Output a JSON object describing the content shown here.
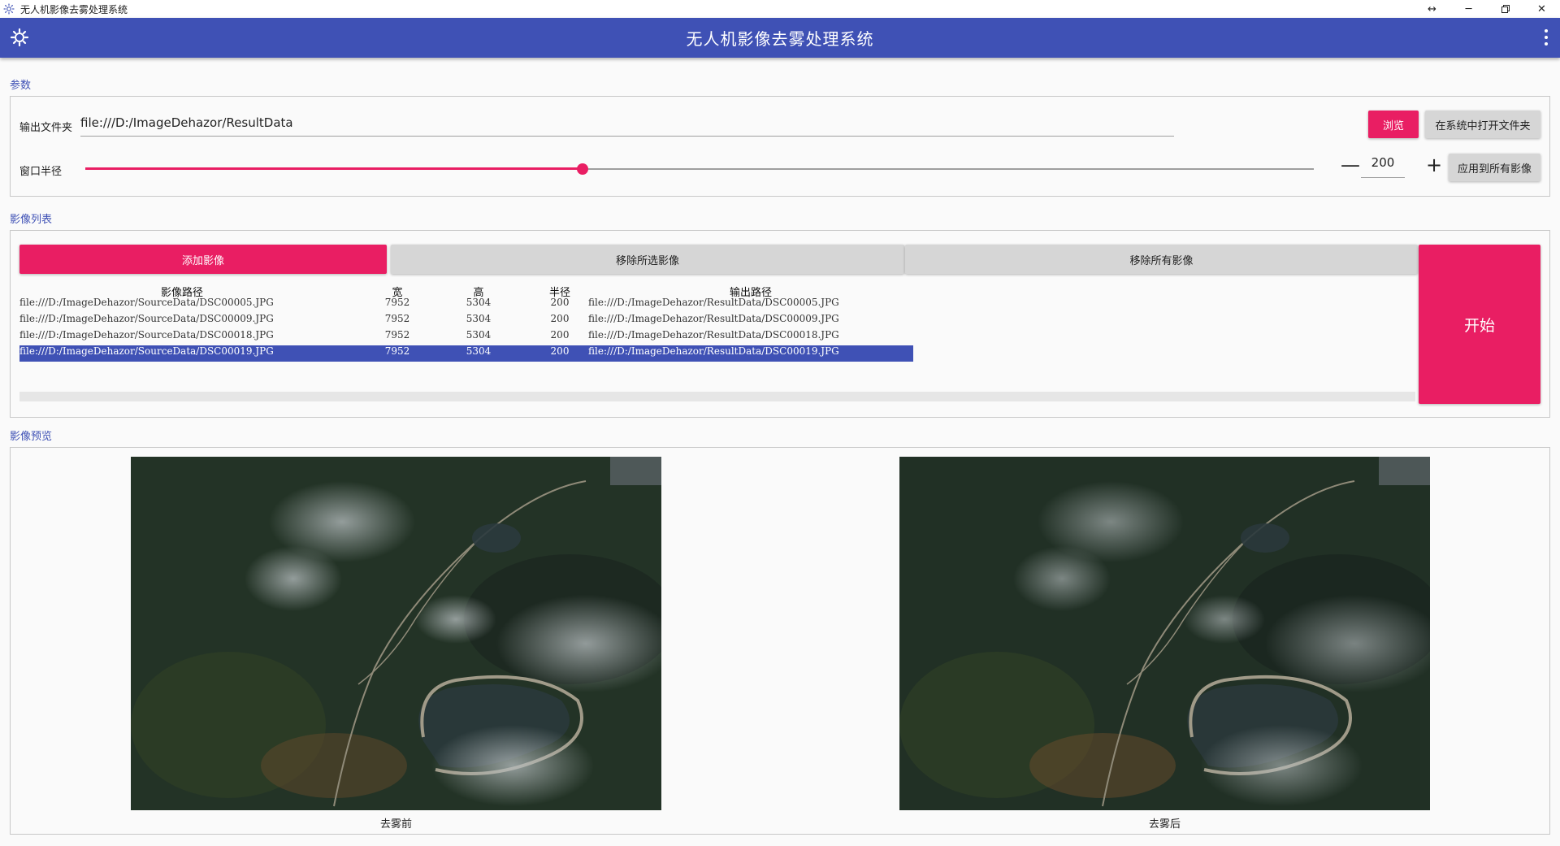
{
  "window": {
    "title": "无人机影像去雾处理系统",
    "icons": [
      "app-gear-icon",
      "resize-icon",
      "minimize-icon",
      "restore-icon",
      "close-icon"
    ]
  },
  "appbar": {
    "title": "无人机影像去雾处理系统"
  },
  "params": {
    "section_label": "参数",
    "output_folder_label": "输出文件夹",
    "output_folder_value": "file:///D:/ImageDehazor/ResultData",
    "browse_label": "浏览",
    "open_in_system_label": "在系统中打开文件夹",
    "window_radius_label": "窗口半径",
    "window_radius_value": "200",
    "slider_fraction": 0.405,
    "minus_symbol": "—",
    "plus_symbol": "+",
    "apply_all_label": "应用到所有影像"
  },
  "image_list": {
    "section_label": "影像列表",
    "add_label": "添加影像",
    "remove_selected_label": "移除所选影像",
    "remove_all_label": "移除所有影像",
    "start_label": "开始",
    "columns": [
      "影像路径",
      "宽",
      "高",
      "半径",
      "输出路径"
    ],
    "rows": [
      {
        "path": "file:///D:/ImageDehazor/SourceData/DSC00005.JPG",
        "width": "7952",
        "height": "5304",
        "radius": "200",
        "output": "file:///D:/ImageDehazor/ResultData/DSC00005.JPG"
      },
      {
        "path": "file:///D:/ImageDehazor/SourceData/DSC00009.JPG",
        "width": "7952",
        "height": "5304",
        "radius": "200",
        "output": "file:///D:/ImageDehazor/ResultData/DSC00009.JPG"
      },
      {
        "path": "file:///D:/ImageDehazor/SourceData/DSC00018.JPG",
        "width": "7952",
        "height": "5304",
        "radius": "200",
        "output": "file:///D:/ImageDehazor/ResultData/DSC00018.JPG"
      },
      {
        "path": "file:///D:/ImageDehazor/SourceData/DSC00019.JPG",
        "width": "7952",
        "height": "5304",
        "radius": "200",
        "output": "file:///D:/ImageDehazor/ResultData/DSC00019.JPG"
      }
    ],
    "selected_row": 3
  },
  "preview": {
    "section_label": "影像预览",
    "before_caption": "去雾前",
    "after_caption": "去雾后"
  },
  "colors": {
    "primary": "#3f51b5",
    "accent": "#e91e63",
    "button_gray": "#d6d6d6"
  }
}
